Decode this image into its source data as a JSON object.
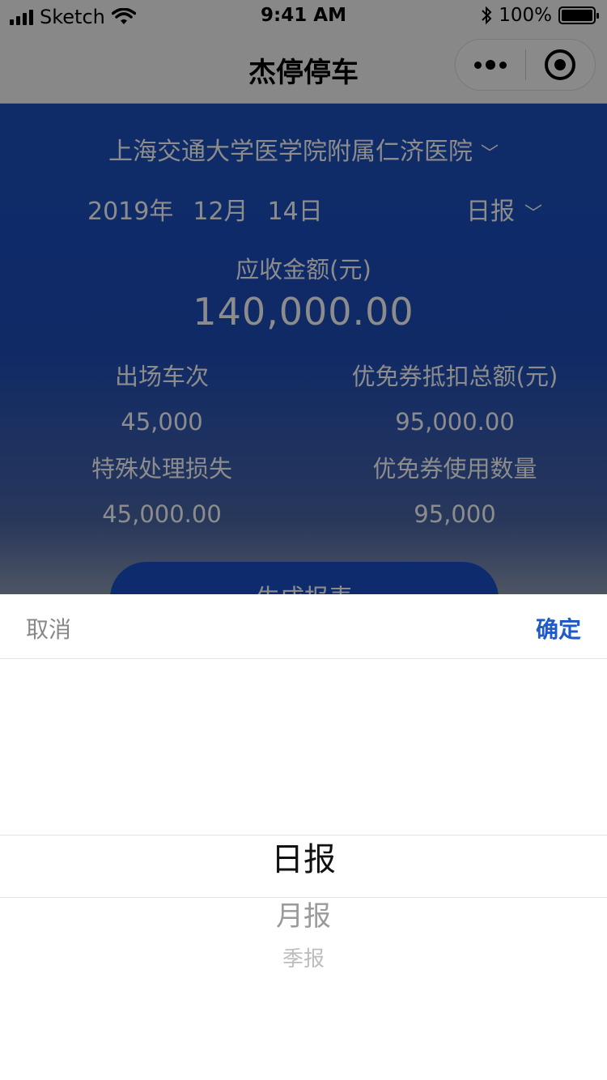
{
  "status_bar": {
    "carrier": "Sketch",
    "time": "9:41 AM",
    "battery": "100%"
  },
  "nav": {
    "title": "杰停停车"
  },
  "main": {
    "hospital": "上海交通大学医学院附属仁济医院",
    "date": {
      "year": "2019年",
      "month": "12月",
      "day": "14日"
    },
    "report_type": "日报",
    "amount_label": "应收金额(元)",
    "amount_value": "140,000.00",
    "stats": [
      {
        "label": "出场车次",
        "value": "45,000"
      },
      {
        "label": "优免券抵扣总额(元)",
        "value": "95,000.00"
      },
      {
        "label": "特殊处理损失",
        "value": "45,000.00"
      },
      {
        "label": "优免券使用数量",
        "value": "95,000"
      }
    ],
    "generate_button": "生成报表"
  },
  "picker": {
    "cancel": "取消",
    "confirm": "确定",
    "options": [
      "日报",
      "月报",
      "季报"
    ],
    "selected": "日报"
  },
  "colors": {
    "primary_blue": "#1c50bf",
    "confirm_blue": "#1f5ac8"
  }
}
